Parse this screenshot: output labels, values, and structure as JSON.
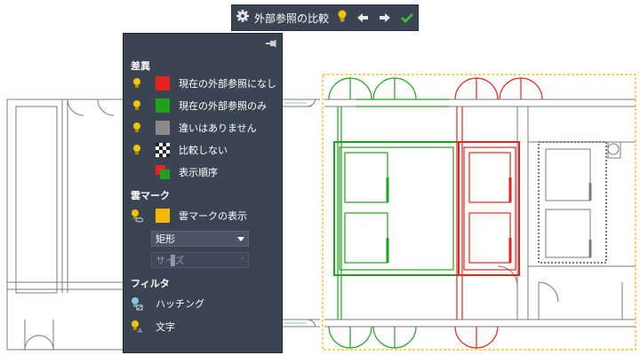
{
  "toolbar": {
    "title": "外部参照の比較",
    "icons": [
      "gear-icon",
      "lightbulb-icon",
      "arrow-left-icon",
      "arrow-right-icon",
      "checkmark-icon"
    ]
  },
  "panel": {
    "sections": {
      "differences": "差異",
      "revcloud": "雲マーク",
      "filter": "フィルタ"
    },
    "diff_rows": [
      {
        "label": "現在の外部参照になし",
        "color": "#e8231e"
      },
      {
        "label": "現在の外部参照のみ",
        "color": "#1ea21e"
      },
      {
        "label": "違いはありません",
        "color": "#8a8a8a"
      },
      {
        "label": "比較しない",
        "swatch": "checker"
      },
      {
        "label": "表示順序",
        "swatch": "red-green-stack"
      }
    ],
    "revcloud": {
      "label": "雲マークの表示",
      "color": "#f5b800",
      "shape_selected": "矩形",
      "size_label": "サイズ"
    },
    "filter_rows": [
      {
        "label": "ハッチング",
        "icon": "hatch-filter-icon"
      },
      {
        "label": "文字",
        "icon": "text-filter-icon"
      }
    ]
  },
  "colors": {
    "panel_bg": "#3b4453",
    "added": "#1ea21e",
    "removed": "#e8231e",
    "unchanged": "#8a8a8a",
    "revcloud": "#f5b800"
  }
}
